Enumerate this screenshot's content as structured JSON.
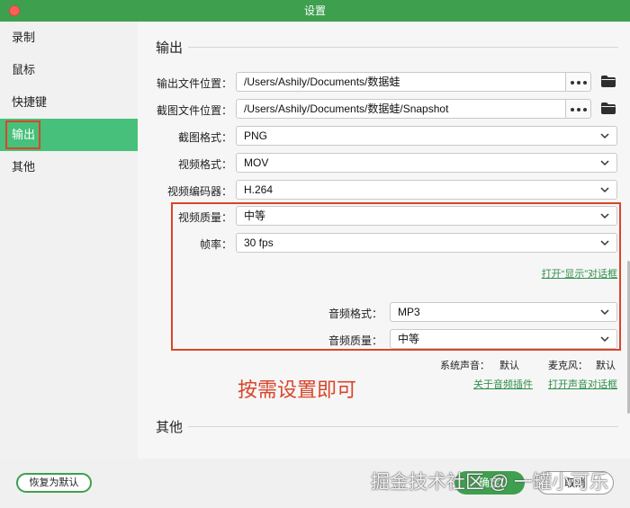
{
  "window": {
    "title": "设置"
  },
  "sidebar": {
    "items": [
      {
        "label": "录制"
      },
      {
        "label": "鼠标"
      },
      {
        "label": "快捷键"
      },
      {
        "label": "输出"
      },
      {
        "label": "其他"
      }
    ],
    "active_index": 3
  },
  "main": {
    "output_section": {
      "title": "输出",
      "output_path": {
        "label": "输出文件位置：",
        "value": "/Users/Ashily/Documents/数据蛙"
      },
      "screenshot_path": {
        "label": "截图文件位置：",
        "value": "/Users/Ashily/Documents/数据蛙/Snapshot"
      },
      "screenshot_format": {
        "label": "截图格式：",
        "value": "PNG"
      },
      "video_format": {
        "label": "视频格式：",
        "value": "MOV"
      },
      "video_encoder": {
        "label": "视频编码器：",
        "value": "H.264"
      },
      "video_quality": {
        "label": "视频质量：",
        "value": "中等"
      },
      "frame_rate": {
        "label": "帧率：",
        "value": "30 fps"
      },
      "display_dialog_link": "打开“显示”对话框",
      "audio_format": {
        "label": "音频格式：",
        "value": "MP3"
      },
      "audio_quality": {
        "label": "音频质量：",
        "value": "中等"
      },
      "system_sound": {
        "label": "系统声音：",
        "value": "默认"
      },
      "microphone": {
        "label": "麦克风：",
        "value": "默认"
      },
      "audio_plugin_link": "关于音频插件",
      "sound_dialog_link": "打开声音对话框"
    },
    "annotation": "按需设置即可",
    "other_section": {
      "title": "其他"
    }
  },
  "footer": {
    "reset_label": "恢复为默认",
    "ok_label": "确定",
    "cancel_label": "取消"
  },
  "watermark": "掘金技术社区 @ 一罐小可乐",
  "colors": {
    "accent": "#3e9f4f",
    "sidebar_active": "#46c07a",
    "highlight": "#d9452a",
    "link": "#2f8f4a"
  }
}
